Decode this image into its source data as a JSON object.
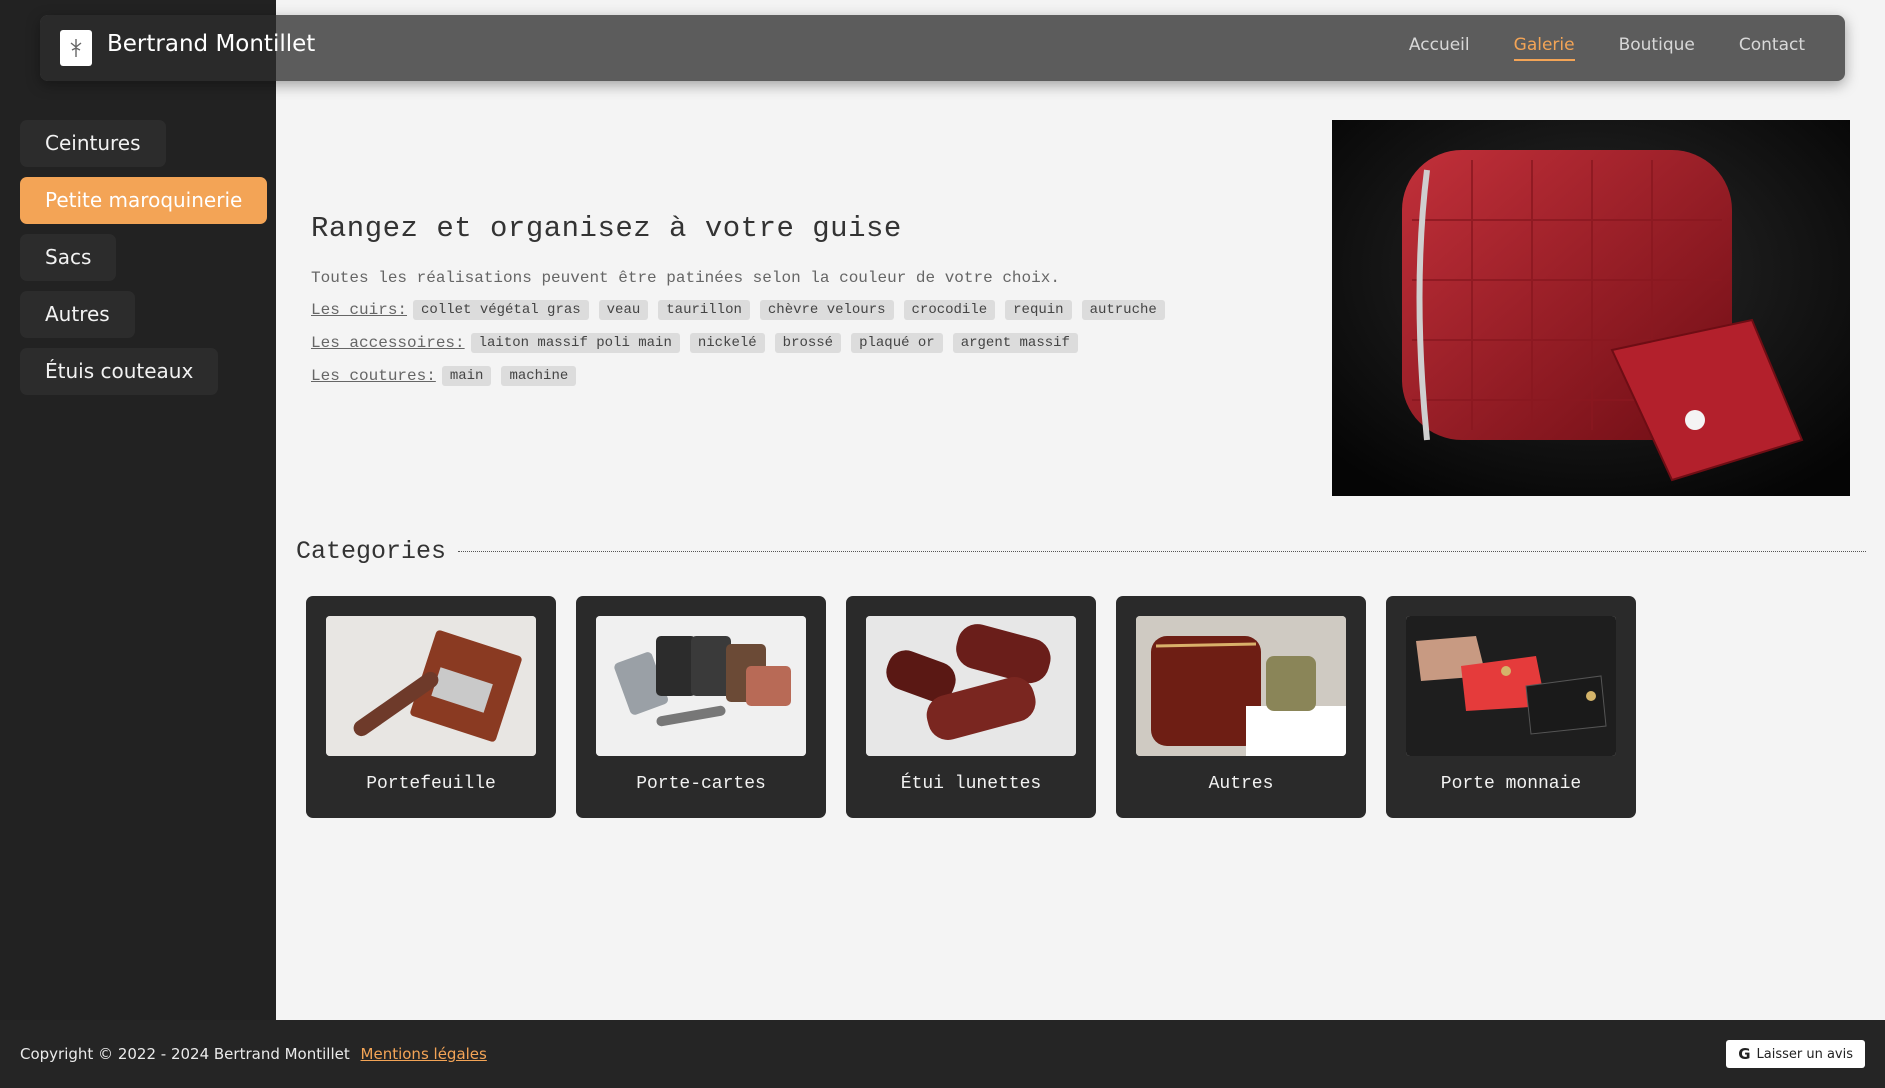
{
  "header": {
    "brand": "Bertrand Montillet",
    "nav": [
      {
        "label": "Accueil",
        "active": false
      },
      {
        "label": "Galerie",
        "active": true
      },
      {
        "label": "Boutique",
        "active": false
      },
      {
        "label": "Contact",
        "active": false
      }
    ]
  },
  "sidebar": {
    "items": [
      {
        "label": "Ceintures",
        "active": false
      },
      {
        "label": "Petite maroquinerie",
        "active": true
      },
      {
        "label": "Sacs",
        "active": false
      },
      {
        "label": "Autres",
        "active": false
      },
      {
        "label": "Étuis couteaux",
        "active": false
      }
    ]
  },
  "hero": {
    "title": "Rangez et organisez à votre guise",
    "subtitle": "Toutes les réalisations peuvent être patinées selon la couleur de votre choix.",
    "rows": [
      {
        "label": "Les cuirs:",
        "tags": [
          "collet végétal gras",
          "veau",
          "taurillon",
          "chèvre velours",
          "crocodile",
          "requin",
          "autruche"
        ]
      },
      {
        "label": "Les accessoires:",
        "tags": [
          "laiton massif poli main",
          "nickelé",
          "brossé",
          "plaqué or",
          "argent massif"
        ]
      },
      {
        "label": "Les coutures:",
        "tags": [
          "main",
          "machine"
        ]
      }
    ]
  },
  "categories": {
    "title": "Categories",
    "items": [
      {
        "label": "Portefeuille"
      },
      {
        "label": "Porte-cartes"
      },
      {
        "label": "Étui lunettes"
      },
      {
        "label": "Autres"
      },
      {
        "label": "Porte monnaie"
      }
    ]
  },
  "footer": {
    "copyright": "Copyright © 2022 - 2024 Bertrand Montillet",
    "legal": "Mentions légales",
    "review": "Laisser un avis"
  },
  "colors": {
    "accent": "#f3a456",
    "sidebar_bg": "#222222",
    "header_bg": "#5c5c5c",
    "card_bg": "#2a2a2a"
  }
}
